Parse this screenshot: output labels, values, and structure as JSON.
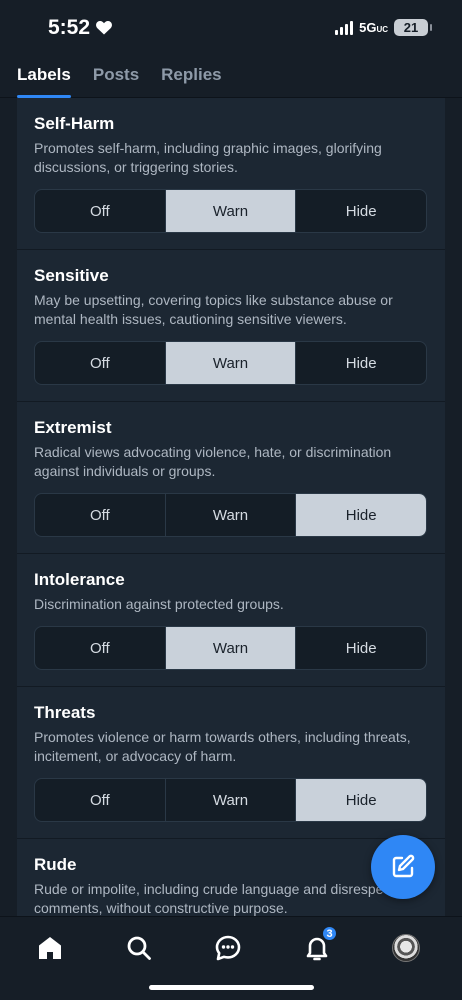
{
  "status_bar": {
    "time": "5:52",
    "network": "5G",
    "network_suffix": "UC",
    "battery": "21"
  },
  "tabs": [
    {
      "label": "Labels",
      "active": true
    },
    {
      "label": "Posts",
      "active": false
    },
    {
      "label": "Replies",
      "active": false
    }
  ],
  "options": [
    "Off",
    "Warn",
    "Hide"
  ],
  "labels": [
    {
      "title": "Self-Harm",
      "description": "Promotes self-harm, including graphic images, glorifying discussions, or triggering stories.",
      "selected": "Warn"
    },
    {
      "title": "Sensitive",
      "description": "May be upsetting, covering topics like substance abuse or mental health issues, cautioning sensitive viewers.",
      "selected": "Warn"
    },
    {
      "title": "Extremist",
      "description": "Radical views advocating violence, hate, or discrimination against individuals or groups.",
      "selected": "Hide"
    },
    {
      "title": "Intolerance",
      "description": "Discrimination against protected groups.",
      "selected": "Warn"
    },
    {
      "title": "Threats",
      "description": "Promotes violence or harm towards others, including threats, incitement, or advocacy of harm.",
      "selected": "Hide"
    },
    {
      "title": "Rude",
      "description": "Rude or impolite, including crude language and disrespectful comments, without constructive purpose.",
      "selected": ""
    }
  ],
  "bottom_nav": {
    "items": [
      "home-icon",
      "search-icon",
      "chat-icon",
      "bell-icon",
      "avatar"
    ],
    "notification_count": "3"
  },
  "colors": {
    "accent": "#2f87f5",
    "background": "#161e27",
    "card": "#1c2733",
    "selected_segment": "#c9d1da"
  }
}
